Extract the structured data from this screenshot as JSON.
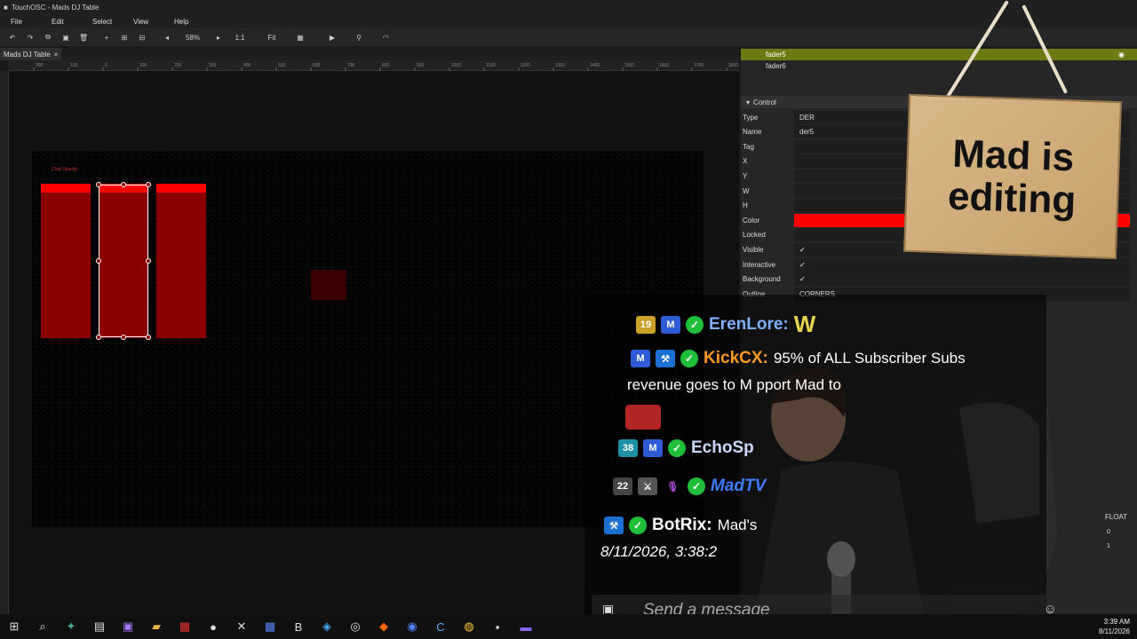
{
  "window": {
    "title": "TouchOSC - Mads DJ Table"
  },
  "menu": [
    "File",
    "Edit",
    "Select",
    "View",
    "Help"
  ],
  "toolbar": {
    "zoom": "58%",
    "one_to_one": "1:1",
    "fit": "Fit"
  },
  "tab": {
    "label": "Mads DJ Table"
  },
  "ruler": {
    "ticks": [
      "200",
      "100",
      "0",
      "100",
      "200",
      "300",
      "400",
      "500",
      "600",
      "700",
      "800",
      "900",
      "1000",
      "1100",
      "1200",
      "1300",
      "1400",
      "1500",
      "1600",
      "1700",
      "1800",
      "1900",
      "2000"
    ]
  },
  "layout": {
    "small_label": "Chat Opacity"
  },
  "tree": {
    "items": [
      "fader5",
      "fader6"
    ]
  },
  "control": {
    "header": "Control",
    "props": [
      {
        "label": "Type",
        "value": "DER"
      },
      {
        "label": "Name",
        "value": "der5"
      },
      {
        "label": "Tag",
        "value": ""
      },
      {
        "label": "X",
        "value": ""
      },
      {
        "label": "Y",
        "value": ""
      },
      {
        "label": "W",
        "value": ""
      },
      {
        "label": "H",
        "value": ""
      },
      {
        "label": "Color",
        "value": ""
      },
      {
        "label": "Locked",
        "value": ""
      },
      {
        "label": "Visible",
        "value": "✓"
      },
      {
        "label": "Interactive",
        "value": "✓"
      },
      {
        "label": "Background",
        "value": "✓"
      },
      {
        "label": "Outline",
        "value": "CORNERS"
      }
    ],
    "float_label": "FLOAT",
    "float_vals": [
      "0",
      "1"
    ],
    "accent": "#ff0000"
  },
  "sign": {
    "text": "Mad is editing"
  },
  "chat": {
    "lines": [
      {
        "badges": [
          "19",
          "M"
        ],
        "name": "ErenLore:",
        "name_color": "#7fb0ff",
        "msg": "W",
        "msg_color": "#e8d44d"
      },
      {
        "badges": [
          "M",
          "hammer"
        ],
        "name": "KickCX:",
        "name_color": "#ff9a1f",
        "msg": "95% of ALL Subscriber Subs",
        "msg_color": "#ffffff"
      },
      {
        "cont": "revenue goes to M        pport Mad to"
      },
      {
        "badges": [
          "38",
          "M"
        ],
        "name": "EchoSp",
        "name_color": "#c8d8ff",
        "msg": "",
        "msg_color": "#fff"
      },
      {
        "badges": [
          "22",
          "sword",
          "mic"
        ],
        "name": "MadTV",
        "name_color": "#3d7bff",
        "msg": "",
        "msg_color": "#fff"
      },
      {
        "badges": [
          "hammer"
        ],
        "name": "BotRix:",
        "name_color": "#ffffff",
        "msg": "Mad's",
        "msg_color": "#ffffff"
      }
    ],
    "timestamp": "8/11/2026, 3:38:2",
    "placeholder": "Send a message"
  },
  "taskbar": {
    "time": "3:39 AM",
    "date": "8/11/2026"
  },
  "colors": {
    "fader_body": "#8b0000",
    "fader_cap": "#ff0000",
    "tree_sel": "#6d7a12"
  }
}
